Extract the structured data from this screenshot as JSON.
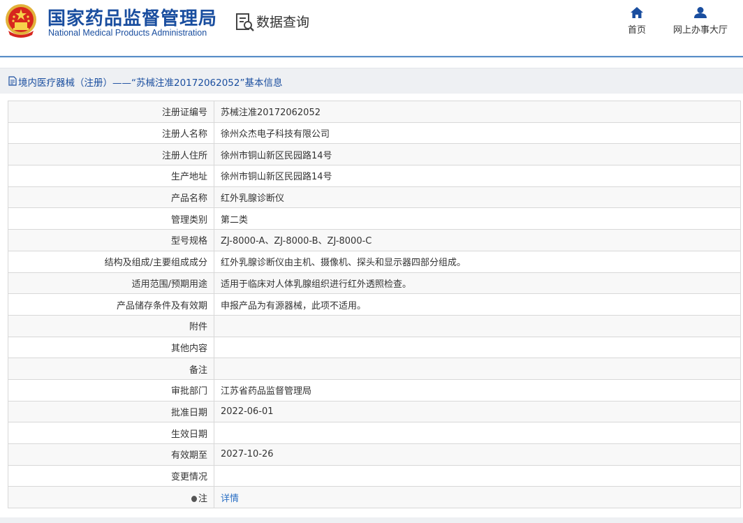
{
  "header": {
    "title_cn": "国家药品监督管理局",
    "title_en": "National Medical Products Administration",
    "query_label": "数据查询",
    "nav": [
      {
        "label": "首页",
        "icon": "home-icon"
      },
      {
        "label": "网上办事大厅",
        "icon": "user-icon"
      }
    ]
  },
  "breadcrumb": {
    "text": "境内医疗器械（注册）——“苏械注准20172062052”基本信息"
  },
  "details": [
    {
      "label": "注册证编号",
      "value": "苏械注准20172062052"
    },
    {
      "label": "注册人名称",
      "value": "徐州众杰电子科技有限公司"
    },
    {
      "label": "注册人住所",
      "value": "徐州市铜山新区民园路14号"
    },
    {
      "label": "生产地址",
      "value": "徐州市铜山新区民园路14号"
    },
    {
      "label": "产品名称",
      "value": "红外乳腺诊断仪"
    },
    {
      "label": "管理类别",
      "value": "第二类"
    },
    {
      "label": "型号规格",
      "value": "ZJ-8000-A、ZJ-8000-B、ZJ-8000-C"
    },
    {
      "label": "结构及组成/主要组成成分",
      "value": "红外乳腺诊断仪由主机、摄像机、探头和显示器四部分组成。"
    },
    {
      "label": "适用范围/预期用途",
      "value": "适用于临床对人体乳腺组织进行红外透照检查。"
    },
    {
      "label": "产品储存条件及有效期",
      "value": "申报产品为有源器械，此项不适用。"
    },
    {
      "label": "附件",
      "value": ""
    },
    {
      "label": "其他内容",
      "value": ""
    },
    {
      "label": "备注",
      "value": ""
    },
    {
      "label": "审批部门",
      "value": "江苏省药品监督管理局"
    },
    {
      "label": "批准日期",
      "value": "2022-06-01"
    },
    {
      "label": "生效日期",
      "value": ""
    },
    {
      "label": "有效期至",
      "value": "2027-10-26"
    },
    {
      "label": "变更情况",
      "value": ""
    }
  ],
  "note": {
    "label": "注",
    "link": "详情"
  },
  "colors": {
    "brand": "#1a4e9f",
    "link": "#2a6fc4",
    "row_alt": "#f8f8f8",
    "crumb_bg": "#eef0f3"
  }
}
